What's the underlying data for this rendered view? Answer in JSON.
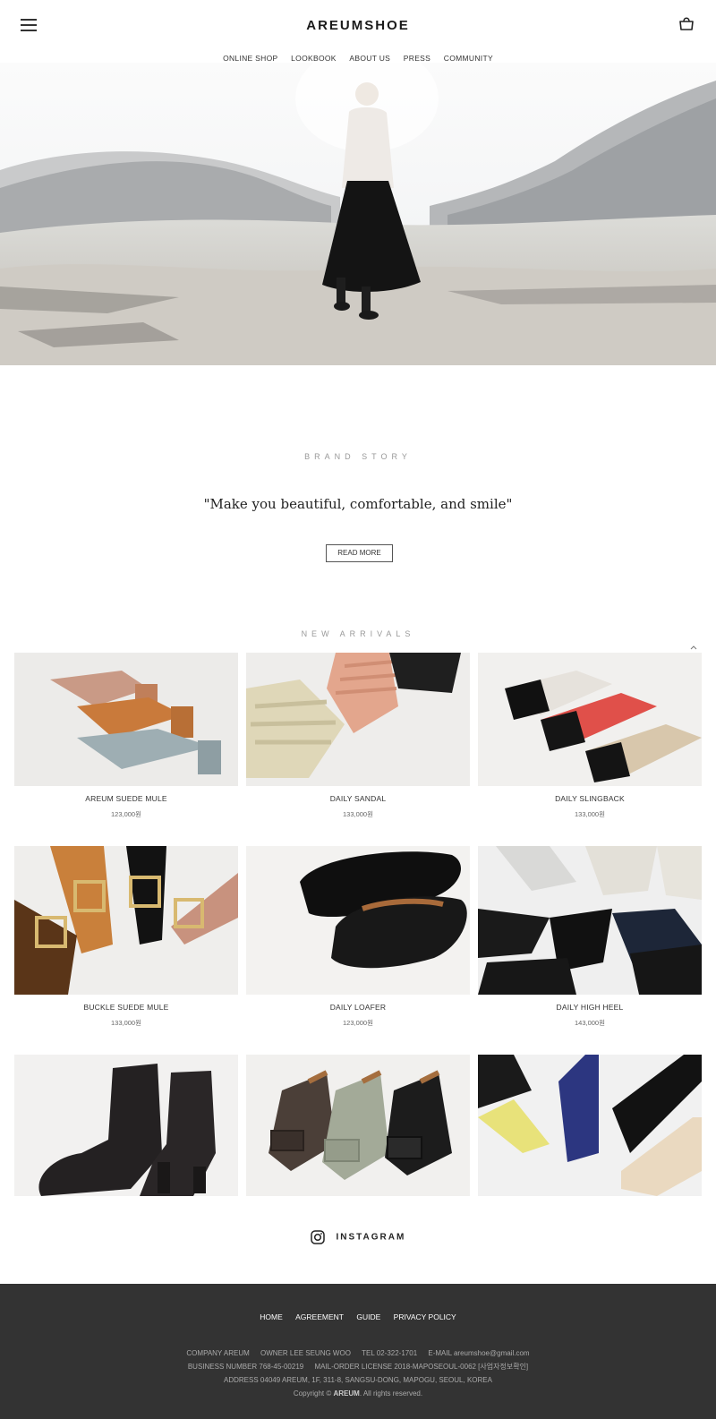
{
  "header": {
    "logo": "AREUMSHOE",
    "nav": [
      "ONLINE SHOP",
      "LOOKBOOK",
      "ABOUT US",
      "PRESS",
      "COMMUNITY"
    ]
  },
  "brand": {
    "title": "BRAND STORY",
    "quote": "\"Make you beautiful, comfortable, and smile\"",
    "button": "READ MORE"
  },
  "arrivals": {
    "title": "NEW ARRIVALS",
    "products": [
      {
        "name": "AREUM SUEDE MULE",
        "price": "123,000원"
      },
      {
        "name": "DAILY SANDAL",
        "price": "133,000원"
      },
      {
        "name": "DAILY SLINGBACK",
        "price": "133,000원"
      },
      {
        "name": "BUCKLE SUEDE MULE",
        "price": "133,000원"
      },
      {
        "name": "DAILY LOAFER",
        "price": "123,000원"
      },
      {
        "name": "DAILY HIGH HEEL",
        "price": "143,000원"
      }
    ]
  },
  "instagram": "INSTAGRAM",
  "footer": {
    "links": [
      "HOME",
      "AGREEMENT",
      "GUIDE",
      "PRIVACY POLICY"
    ],
    "company": "COMPANY AREUM",
    "owner": "OWNER LEE SEUNG WOO",
    "tel": "TEL 02-322-1701",
    "email": "E-MAIL areumshoe@gmail.com",
    "business": "BUSINESS NUMBER 768-45-00219",
    "license": "MAIL-ORDER LICENSE 2018-MAPOSEOUL-0062 [사업자정보확인]",
    "address": "ADDRESS 04049 AREUM, 1F, 311-8, SANGSU-DONG, MAPOGU, SEOUL, KOREA",
    "copyright_pre": "Copyright © ",
    "copyright_brand": "AREUM",
    "copyright_post": ". All rights reserved."
  }
}
